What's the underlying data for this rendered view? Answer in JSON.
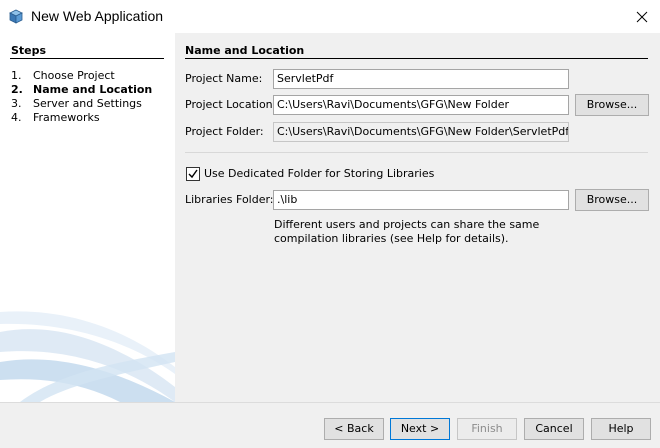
{
  "window": {
    "title": "New Web Application",
    "app_icon": "netbeans-cube-icon",
    "close_icon": "close-icon"
  },
  "steps": {
    "heading": "Steps",
    "items": [
      {
        "num": "1.",
        "label": "Choose Project"
      },
      {
        "num": "2.",
        "label": "Name and Location",
        "current": true
      },
      {
        "num": "3.",
        "label": "Server and Settings"
      },
      {
        "num": "4.",
        "label": "Frameworks"
      }
    ]
  },
  "main": {
    "title": "Name and Location",
    "project_name_label": "Project Name:",
    "project_name_value": "ServletPdf",
    "project_location_label": "Project Location:",
    "project_location_value": "C:\\Users\\Ravi\\Documents\\GFG\\New Folder",
    "project_folder_label": "Project Folder:",
    "project_folder_value": "C:\\Users\\Ravi\\Documents\\GFG\\New Folder\\ServletPdf",
    "browse_label": "Browse...",
    "dedicated_folder_label": "Use Dedicated Folder for Storing Libraries",
    "dedicated_folder_checked": true,
    "libraries_folder_label": "Libraries Folder:",
    "libraries_folder_value": ".\\lib",
    "help_text": "Different users and projects can share the same compilation libraries (see Help for details)."
  },
  "footer": {
    "back_label": "< Back",
    "next_label": "Next >",
    "finish_label": "Finish",
    "cancel_label": "Cancel",
    "help_label": "Help"
  },
  "colors": {
    "accent": "#0078d7",
    "panel": "#f0f0f0"
  }
}
